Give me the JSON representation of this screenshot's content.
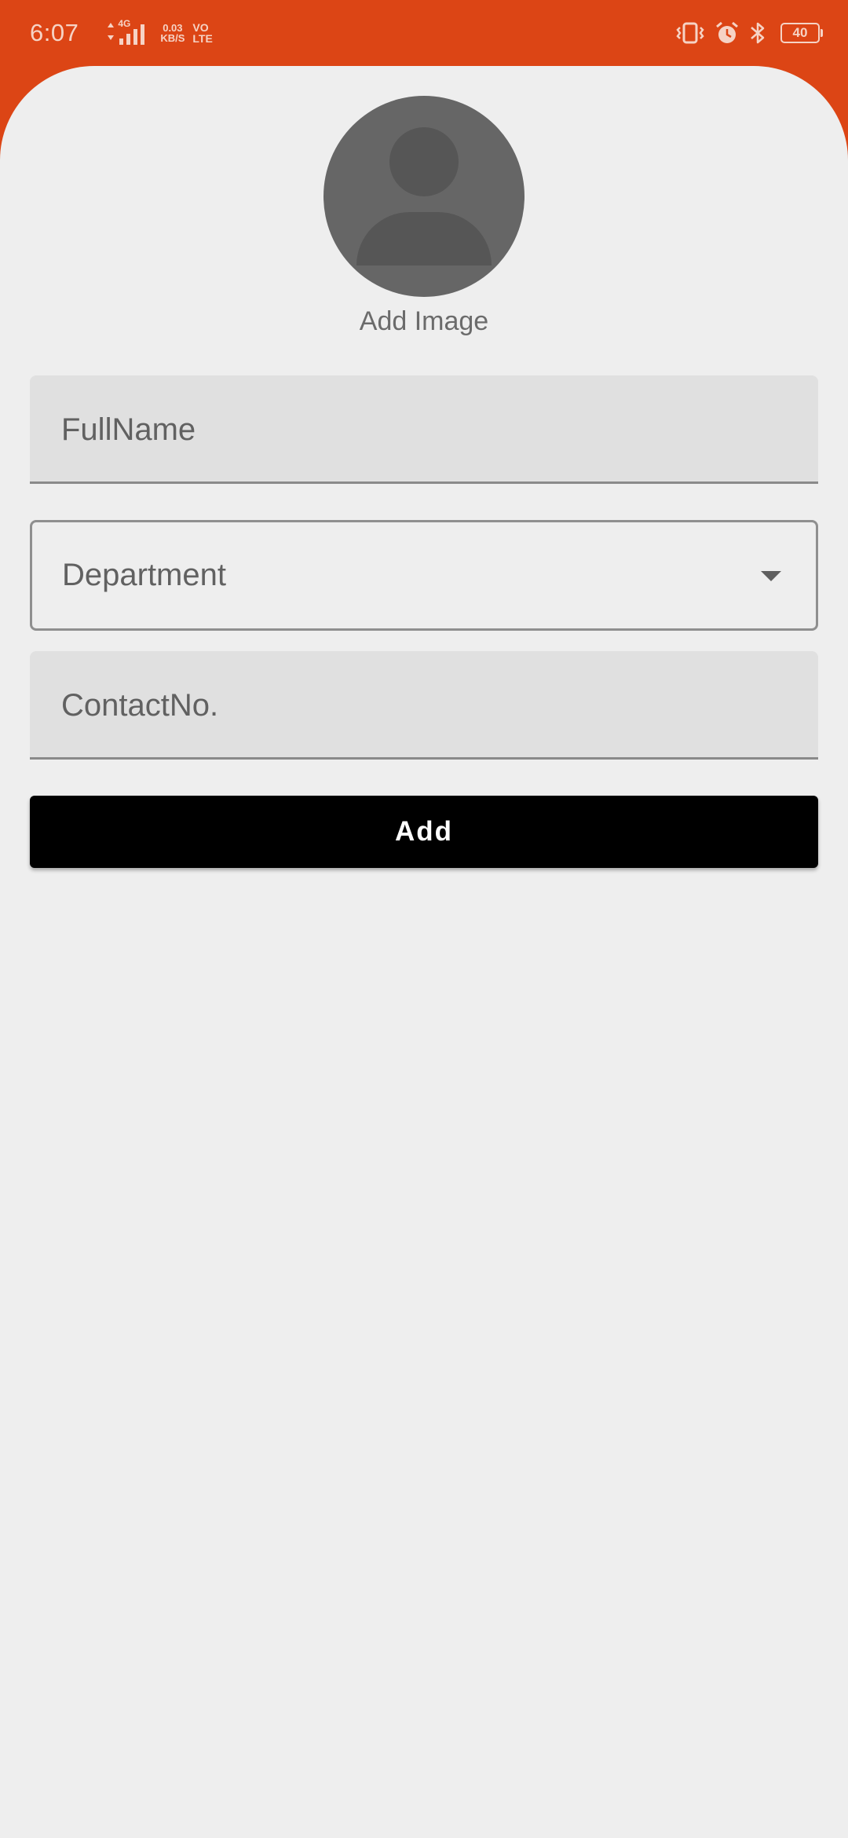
{
  "status_bar": {
    "time": "6:07",
    "network_type": "4G",
    "speed_value": "0.03",
    "speed_unit": "KB/S",
    "volte_top": "VO",
    "volte_bottom": "LTE",
    "battery_level": "40",
    "icons": [
      "vibrate-icon",
      "alarm-icon",
      "bluetooth-icon",
      "battery-icon"
    ],
    "background_color": "#dc4515"
  },
  "form": {
    "add_image_label": "Add Image",
    "avatar_icon": "person-placeholder-icon",
    "fullname_placeholder": "FullName",
    "department_placeholder": "Department",
    "department_arrow_icon": "dropdown-arrow-icon",
    "contact_placeholder": "ContactNo.",
    "add_button_label": "Add"
  },
  "colors": {
    "accent": "#dc4515",
    "background": "#eeeeee",
    "field_fill": "#e0e0e0",
    "button": "#000000"
  }
}
